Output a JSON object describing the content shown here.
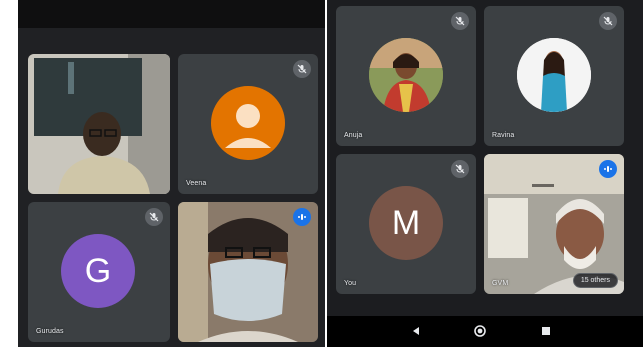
{
  "participants_left": [
    {
      "name": "",
      "type": "video",
      "muted": false
    },
    {
      "name": "Veena",
      "type": "avatar-icon",
      "muted": true,
      "avatar_color": "#e37400"
    },
    {
      "name": "Gurudas",
      "type": "letter",
      "letter": "G",
      "muted": true,
      "avatar_color": "#7e57c2"
    },
    {
      "name": "",
      "type": "video",
      "muted": false,
      "speaking": true
    }
  ],
  "participants_right": [
    {
      "name": "Anuja",
      "type": "photo",
      "muted": true
    },
    {
      "name": "Ravina",
      "type": "photo",
      "muted": true
    },
    {
      "name": "You",
      "type": "letter",
      "letter": "M",
      "muted": true,
      "avatar_color": "#795548"
    },
    {
      "name": "GVM",
      "type": "video",
      "muted": false,
      "speaking": true
    }
  ],
  "others_count_label": "15 others",
  "colors": {
    "tile_bg": "#3c4043",
    "speaking_indicator": "#1a73e8",
    "mic_badge": "#5f6368"
  },
  "icons": [
    "mic-off-icon",
    "speaking-indicator-icon",
    "person-icon",
    "back-icon",
    "home-icon",
    "recents-icon"
  ]
}
